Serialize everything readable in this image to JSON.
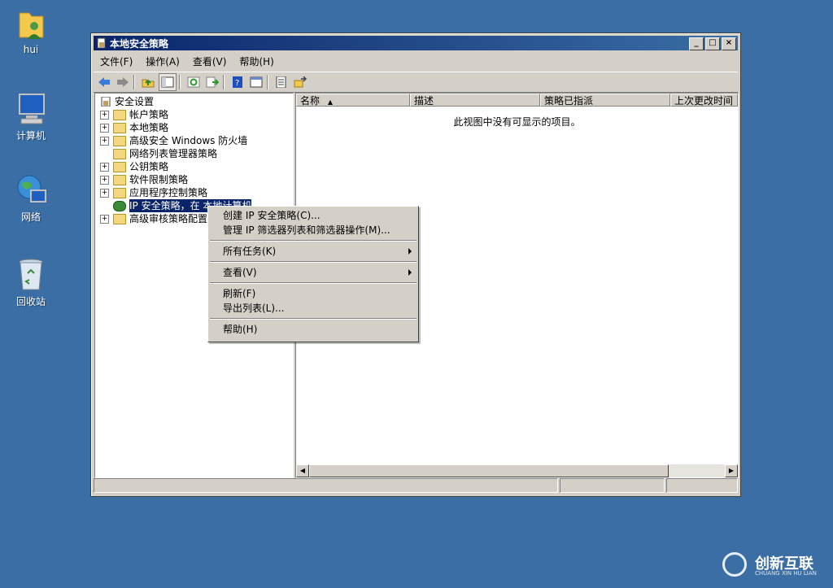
{
  "desktop": {
    "icons": [
      {
        "label": "hui",
        "icon": "user-folder-icon"
      },
      {
        "label": "计算机",
        "icon": "computer-icon"
      },
      {
        "label": "网络",
        "icon": "network-icon"
      },
      {
        "label": "回收站",
        "icon": "recycle-bin-icon"
      }
    ]
  },
  "window": {
    "title": "本地安全策略",
    "controls": {
      "minimize": "_",
      "maximize": "□",
      "close": "×"
    }
  },
  "menubar": {
    "items": [
      "文件(F)",
      "操作(A)",
      "查看(V)",
      "帮助(H)"
    ]
  },
  "toolbar": {
    "icons": [
      "back-icon",
      "forward-icon",
      "up-folder-icon",
      "show-hide-tree-icon",
      "refresh-icon",
      "export-list-icon",
      "help-icon",
      "properties-icon",
      "new-policy-icon",
      "filter-icon"
    ]
  },
  "tree": {
    "root": "安全设置",
    "items": [
      {
        "label": "帐户策略",
        "expander": "+"
      },
      {
        "label": "本地策略",
        "expander": "+"
      },
      {
        "label": "高级安全 Windows 防火墙",
        "expander": "+"
      },
      {
        "label": "网络列表管理器策略",
        "expander": ""
      },
      {
        "label": "公钥策略",
        "expander": "+"
      },
      {
        "label": "软件限制策略",
        "expander": "+"
      },
      {
        "label": "应用程序控制策略",
        "expander": "+"
      },
      {
        "label": "IP 安全策略，在 本地计算机",
        "expander": "",
        "selected": true
      },
      {
        "label": "高级审核策略配置",
        "expander": "+"
      }
    ]
  },
  "list": {
    "columns": [
      "名称",
      "描述",
      "策略已指派",
      "上次更改时间"
    ],
    "empty_message": "此视图中没有可显示的项目。"
  },
  "context_menu": {
    "items": [
      {
        "label": "创建 IP 安全策略(C)..."
      },
      {
        "label": "管理 IP 筛选器列表和筛选器操作(M)..."
      },
      {
        "separator": true
      },
      {
        "label": "所有任务(K)",
        "submenu": true
      },
      {
        "separator": true
      },
      {
        "label": "查看(V)",
        "submenu": true
      },
      {
        "separator": true
      },
      {
        "label": "刷新(F)"
      },
      {
        "label": "导出列表(L)..."
      },
      {
        "separator": true
      },
      {
        "label": "帮助(H)"
      }
    ]
  },
  "watermark": {
    "title": "创新互联",
    "subtitle": "CHUANG XIN HU LIAN"
  }
}
